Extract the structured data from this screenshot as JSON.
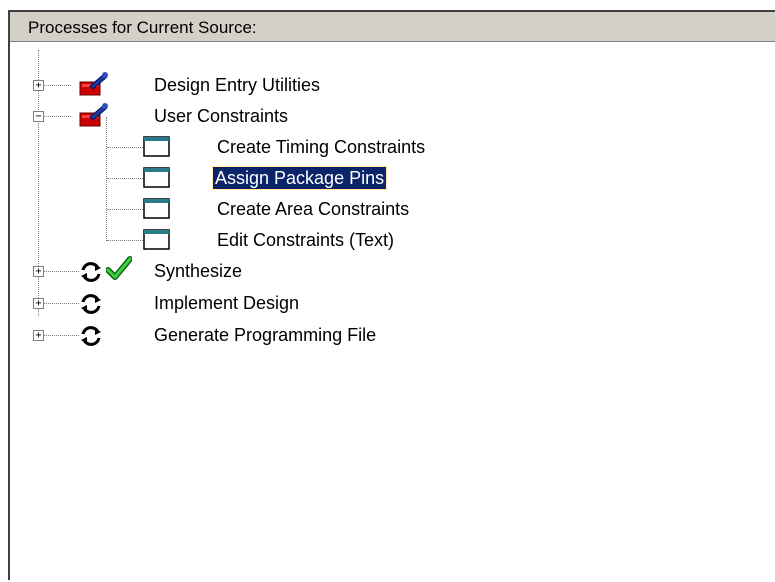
{
  "panel": {
    "title": "Processes for Current Source:"
  },
  "tree": {
    "items": [
      {
        "label": "Design Entry Utilities",
        "expander": "+",
        "icon": "toolbox-icon"
      },
      {
        "label": "User Constraints",
        "expander": "−",
        "icon": "toolbox-icon",
        "children": [
          {
            "label": "Create Timing Constraints",
            "icon": "window-icon"
          },
          {
            "label": "Assign Package Pins",
            "icon": "window-icon",
            "selected": true
          },
          {
            "label": "Create Area Constraints",
            "icon": "window-icon"
          },
          {
            "label": "Edit Constraints (Text)",
            "icon": "window-icon"
          }
        ]
      },
      {
        "label": "Synthesize",
        "expander": "+",
        "icon": "refresh-icon",
        "status_icon": "checkmark-icon"
      },
      {
        "label": "Implement Design",
        "expander": "+",
        "icon": "refresh-icon"
      },
      {
        "label": "Generate Programming File",
        "expander": "+",
        "icon": "refresh-icon"
      }
    ]
  },
  "colors": {
    "selection": "#0a246a",
    "header_bg": "#d4d0c8",
    "check": "#22aa22",
    "toolbox_red": "#cc0000"
  }
}
